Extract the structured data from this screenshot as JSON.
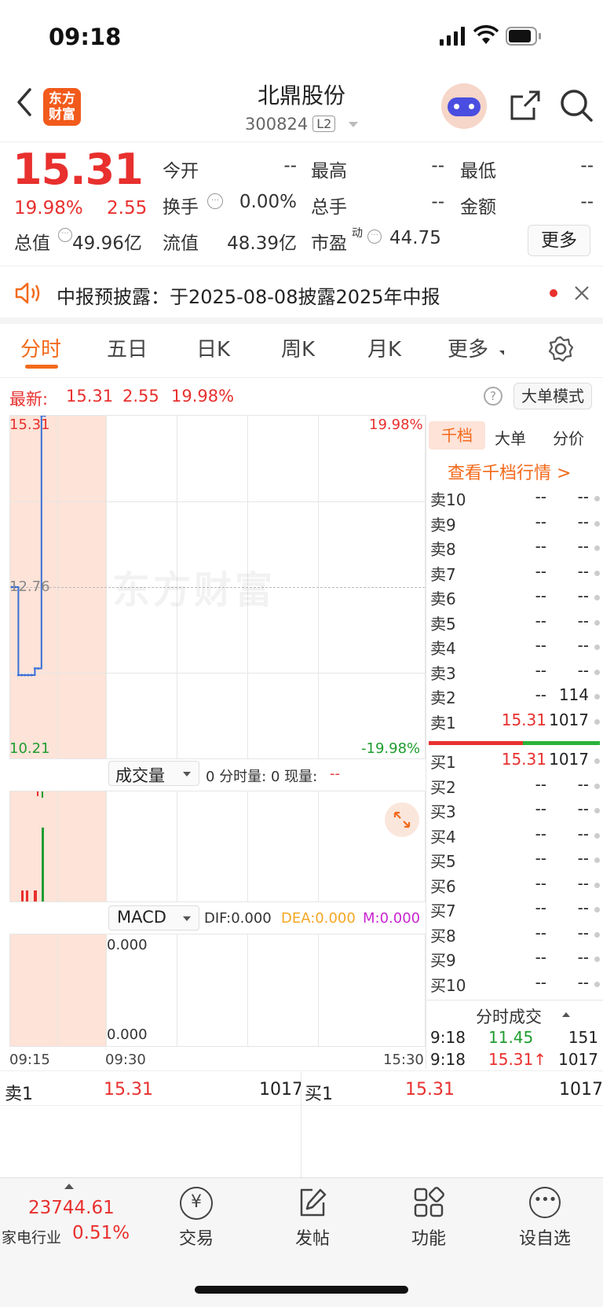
{
  "status": {
    "time": "09:18"
  },
  "header": {
    "logo_text_1": "东方",
    "logo_text_2": "财富",
    "name": "北鼎股份",
    "code": "300824",
    "level": "L2"
  },
  "quote": {
    "price": "15.31",
    "change_pct": "19.98%",
    "change": "2.55",
    "rows": [
      {
        "label": "今开",
        "value": "--"
      },
      {
        "label": "最高",
        "value": "--"
      },
      {
        "label": "最低",
        "value": "--"
      },
      {
        "label": "换手",
        "value": "0.00%"
      },
      {
        "label": "总手",
        "value": "--"
      },
      {
        "label": "金额",
        "value": "--"
      },
      {
        "label": "总值",
        "value": "49.96亿"
      },
      {
        "label": "流值",
        "value": "48.39亿"
      },
      {
        "label": "市盈",
        "value": "44.75",
        "sup": "动"
      }
    ],
    "more": "更多"
  },
  "notice": {
    "text": "中报预披露：于2025-08-08披露2025年中报"
  },
  "tabs": [
    "分时",
    "五日",
    "日K",
    "周K",
    "月K",
    "更多"
  ],
  "latest": {
    "label": "最新:",
    "price": "15.31",
    "change": "2.55",
    "pct": "19.98%",
    "big_order_mode": "大单模式"
  },
  "chart": {
    "y_top": "15.31",
    "y_mid": "12.76",
    "y_bottom": "10.21",
    "pct_top": "19.98%",
    "pct_bottom": "-19.98%",
    "watermark": "东方财富",
    "volume_selector": "成交量",
    "volume_info": "0 分时量: 0 现量:",
    "volume_now": "--",
    "macd_selector": "MACD",
    "dif": "DIF:0.000",
    "dea": "DEA:0.000",
    "m": "M:0.000",
    "macd_top": "0.000",
    "macd_bottom": "0.000",
    "x_labels": [
      "09:15",
      "09:30",
      "15:30"
    ]
  },
  "chart_data": {
    "type": "line",
    "x": [
      "09:15",
      "09:16",
      "09:17",
      "09:18",
      "09:19",
      "09:20",
      "09:21",
      "09:22",
      "09:23",
      "09:24",
      "09:25"
    ],
    "series": [
      {
        "values": [
          12.76,
          12.76,
          11.45,
          11.45,
          11.45,
          11.45,
          11.45,
          11.55,
          11.55,
          15.31,
          15.31
        ]
      }
    ],
    "ylim": [
      10.21,
      15.31
    ],
    "xlabel": "",
    "ylabel": ""
  },
  "orderbook": {
    "tabs": [
      "千档",
      "大单",
      "分价"
    ],
    "link": "查看千档行情 >",
    "sell": [
      {
        "label": "卖10",
        "price": "--",
        "vol": "--"
      },
      {
        "label": "卖9",
        "price": "--",
        "vol": "--"
      },
      {
        "label": "卖8",
        "price": "--",
        "vol": "--"
      },
      {
        "label": "卖7",
        "price": "--",
        "vol": "--"
      },
      {
        "label": "卖6",
        "price": "--",
        "vol": "--"
      },
      {
        "label": "卖5",
        "price": "--",
        "vol": "--"
      },
      {
        "label": "卖4",
        "price": "--",
        "vol": "--"
      },
      {
        "label": "卖3",
        "price": "--",
        "vol": "--"
      },
      {
        "label": "卖2",
        "price": "--",
        "vol": "114"
      },
      {
        "label": "卖1",
        "price": "15.31",
        "vol": "1017"
      }
    ],
    "buy": [
      {
        "label": "买1",
        "price": "15.31",
        "vol": "1017"
      },
      {
        "label": "买2",
        "price": "--",
        "vol": "--"
      },
      {
        "label": "买3",
        "price": "--",
        "vol": "--"
      },
      {
        "label": "买4",
        "price": "--",
        "vol": "--"
      },
      {
        "label": "买5",
        "price": "--",
        "vol": "--"
      },
      {
        "label": "买6",
        "price": "--",
        "vol": "--"
      },
      {
        "label": "买7",
        "price": "--",
        "vol": "--"
      },
      {
        "label": "买8",
        "price": "--",
        "vol": "--"
      },
      {
        "label": "买9",
        "price": "--",
        "vol": "--"
      },
      {
        "label": "买10",
        "price": "--",
        "vol": "--"
      }
    ],
    "ticks_title": "分时成交",
    "ticks": [
      {
        "time": "9:18",
        "price": "11.45",
        "vol": "151"
      },
      {
        "time": "9:18",
        "price": "15.31↑",
        "vol": "1017"
      }
    ]
  },
  "bottom_quote": {
    "sell_label": "卖1",
    "sell_price": "15.31",
    "sell_vol": "1017",
    "buy_label": "买1",
    "buy_price": "15.31",
    "buy_vol": "1017"
  },
  "bottom_nav": {
    "index_value": "23744.61",
    "index_name": "家电行业",
    "index_pct": "0.51%",
    "items": [
      "交易",
      "发帖",
      "功能",
      "设自选"
    ]
  }
}
